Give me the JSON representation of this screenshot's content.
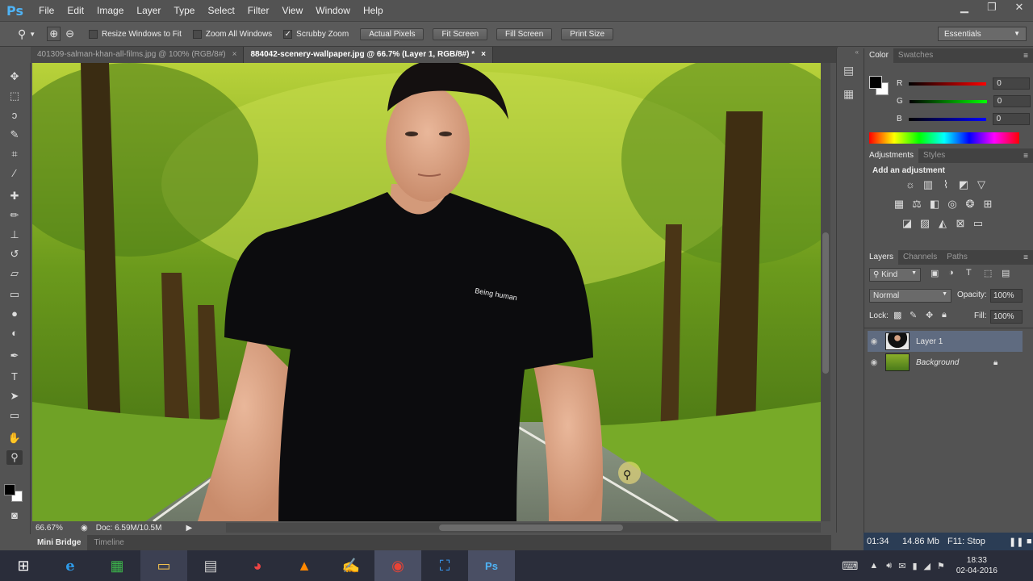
{
  "app": {
    "logo": "Ps"
  },
  "menu": [
    "File",
    "Edit",
    "Image",
    "Layer",
    "Type",
    "Select",
    "Filter",
    "View",
    "Window",
    "Help"
  ],
  "window_controls": {
    "minimize": "▁",
    "restore": "❐",
    "close": "✕"
  },
  "options": {
    "resize_windows": "Resize Windows to Fit",
    "zoom_all": "Zoom All Windows",
    "scrubby": "Scrubby Zoom",
    "actual_pixels": "Actual Pixels",
    "fit_screen": "Fit Screen",
    "fill_screen": "Fill Screen",
    "print_size": "Print Size",
    "workspace": "Essentials"
  },
  "doc_tabs": [
    {
      "label": "401309-salman-khan-all-films.jpg @ 100% (RGB/8#)"
    },
    {
      "label": "884042-scenery-wallpaper.jpg @ 66.7% (Layer 1, RGB/8#) *"
    }
  ],
  "canvas": {
    "shirt_text": "Being human"
  },
  "status": {
    "zoom": "66.67%",
    "doc": "Doc: 6.59M/10.5M"
  },
  "bottom_tabs": [
    "Mini Bridge",
    "Timeline"
  ],
  "color_panel": {
    "tabs": [
      "Color",
      "Swatches"
    ],
    "r_label": "R",
    "g_label": "G",
    "b_label": "B",
    "r": "0",
    "g": "0",
    "b": "0"
  },
  "adjustments": {
    "tabs": [
      "Adjustments",
      "Styles"
    ],
    "title": "Add an adjustment"
  },
  "layers_panel": {
    "tabs": [
      "Layers",
      "Channels",
      "Paths"
    ],
    "filter": "Kind",
    "blend_mode": "Normal",
    "opacity_label": "Opacity:",
    "opacity": "100%",
    "lock_label": "Lock:",
    "fill_label": "Fill:",
    "fill": "100%",
    "layers": [
      {
        "name": "Layer 1"
      },
      {
        "name": "Background"
      }
    ]
  },
  "recording": {
    "time": "01:34",
    "size": "14.86 Mb",
    "stop": "F11: Stop"
  },
  "clock": {
    "time": "18:33",
    "date": "02-04-2016"
  },
  "colors": {
    "accent": "#4fb3f5",
    "layer_selected": "#5f6b80"
  }
}
